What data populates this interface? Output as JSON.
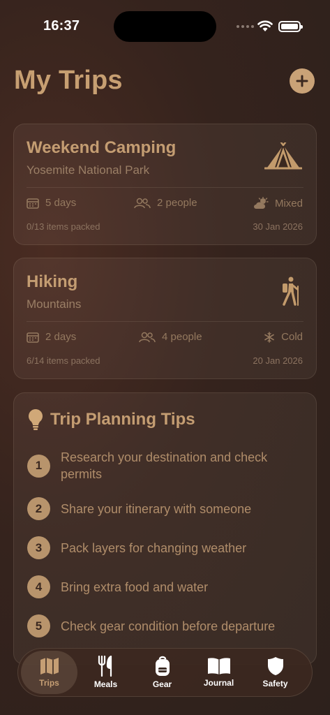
{
  "status_bar": {
    "time": "16:37"
  },
  "header": {
    "title": "My Trips"
  },
  "trips": [
    {
      "title": "Weekend Camping",
      "subtitle": "Yosemite National Park",
      "icon": "tent-icon",
      "duration": "5 days",
      "people": "2 people",
      "weather": "Mixed",
      "packed": "0/13 items packed",
      "date": "30 Jan 2026"
    },
    {
      "title": "Hiking",
      "subtitle": "Mountains",
      "icon": "hiker-icon",
      "duration": "2 days",
      "people": "4 people",
      "weather": "Cold",
      "packed": "6/14 items packed",
      "date": "20 Jan 2026"
    }
  ],
  "tips": {
    "title": "Trip Planning Tips",
    "items": [
      {
        "num": "1",
        "text": "Research your destination and check permits"
      },
      {
        "num": "2",
        "text": "Share your itinerary with someone"
      },
      {
        "num": "3",
        "text": "Pack layers for changing weather"
      },
      {
        "num": "4",
        "text": "Bring extra food and water"
      },
      {
        "num": "5",
        "text": "Check gear condition before departure"
      }
    ]
  },
  "tab_bar": {
    "tabs": [
      {
        "label": "Trips",
        "icon": "map-icon",
        "active": true
      },
      {
        "label": "Meals",
        "icon": "fork-knife-icon",
        "active": false
      },
      {
        "label": "Gear",
        "icon": "backpack-icon",
        "active": false
      },
      {
        "label": "Journal",
        "icon": "book-icon",
        "active": false
      },
      {
        "label": "Safety",
        "icon": "shield-icon",
        "active": false
      }
    ]
  },
  "colors": {
    "accent": "#c9a277",
    "background": "#35231d",
    "text_muted": "#94795f"
  }
}
